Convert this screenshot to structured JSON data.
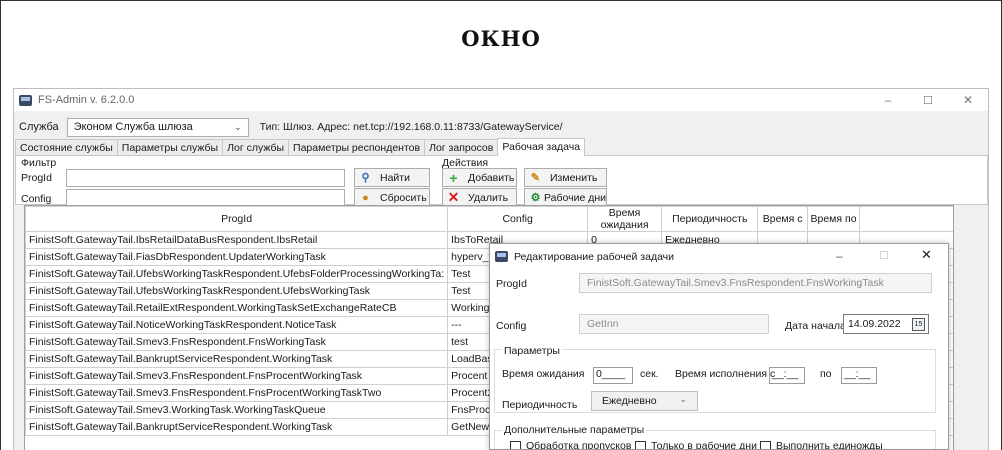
{
  "caption": "ОКНО",
  "window": {
    "title": "FS-Admin v. 6.2.0.0",
    "controls": {
      "minimize": "–",
      "maximize": "☐",
      "close": "✕"
    }
  },
  "service_row": {
    "label": "Служба",
    "selected": "Эконом Служба шлюза",
    "info": "Тип: Шлюз.   Адрес: net.tcp://192.168.0.11:8733/GatewayService/"
  },
  "tabs": [
    "Состояние службы",
    "Параметры службы",
    "Лог службы",
    "Параметры респондентов",
    "Лог запросов",
    "Рабочая задача"
  ],
  "filter": {
    "title": "Фильтр",
    "progid_label": "ProgId",
    "config_label": "Config",
    "find_button": "Найти",
    "reset_button": "Сбросить"
  },
  "actions": {
    "title": "Действия",
    "add": "Добавить",
    "edit": "Изменить",
    "delete": "Удалить",
    "workdays": "Рабочие дни"
  },
  "grid": {
    "columns": [
      "ProgId",
      "Config",
      "Время ожидания",
      "Периодичность",
      "Время с",
      "Время по"
    ],
    "rows": [
      [
        "FinistSoft.GatewayTail.IbsRetailDataBusRespondent.IbsRetail",
        "IbsToRetail",
        "0",
        "Ежедневно",
        "",
        ""
      ],
      [
        "FinistSoft.GatewayTail.FiasDbRespondent.UpdaterWorkingTask",
        "hyperv_fias",
        "",
        "",
        "",
        ""
      ],
      [
        "FinistSoft.GatewayTail.UfebsWorkingTaskRespondent.UfebsFolderProcessingWorkingTa:",
        "Test",
        "",
        "",
        "",
        ""
      ],
      [
        "FinistSoft.GatewayTail.UfebsWorkingTaskRespondent.UfebsWorkingTask",
        "Test",
        "",
        "",
        "",
        ""
      ],
      [
        "FinistSoft.GatewayTail.RetailExtRespondent.WorkingTaskSetExchangeRateCB",
        "WorkingTaskSetExcha",
        "",
        "",
        "",
        ""
      ],
      [
        "FinistSoft.GatewayTail.NoticeWorkingTaskRespondent.NoticeTask",
        "---",
        "",
        "",
        "",
        ""
      ],
      [
        "FinistSoft.GatewayTail.Smev3.FnsRespondent.FnsWorkingTask",
        "test",
        "",
        "",
        "",
        ""
      ],
      [
        "FinistSoft.GatewayTail.BankruptServiceRespondent.WorkingTask",
        "LoadBase",
        "",
        "",
        "",
        ""
      ],
      [
        "FinistSoft.GatewayTail.Smev3.FnsRespondent.FnsProcentWorkingTask",
        "Procent",
        "",
        "",
        "",
        ""
      ],
      [
        "FinistSoft.GatewayTail.Smev3.FnsRespondent.FnsProcentWorkingTaskTwo",
        "Procent2",
        "",
        "",
        "",
        ""
      ],
      [
        "FinistSoft.GatewayTail.Smev3.WorkingTask.WorkingTaskQueue",
        "FnsProc",
        "",
        "",
        "",
        ""
      ],
      [
        "FinistSoft.GatewayTail.BankruptServiceRespondent.WorkingTask",
        "GetNewMessage",
        "",
        "",
        "",
        ""
      ]
    ]
  },
  "dialog": {
    "title": "Редактирование рабочей задачи",
    "progid_label": "ProgId",
    "progid_value": "FinistSoft.GatewayTail.Smev3.FnsRespondent.FnsWorkingTask",
    "config_label": "Config",
    "config_value": "GetInn",
    "start_date_label": "Дата начала",
    "start_date_value": "14.09.2022",
    "params_title": "Параметры",
    "wait_label": "Время ожидания",
    "wait_value": "0____",
    "wait_unit": "сек.",
    "exec_time_label": "Время исполнения с",
    "exec_from": "__:__",
    "exec_to_label": "по",
    "exec_to": "__:__",
    "period_label": "Периодичность",
    "period_value": "Ежедневно",
    "extra_title": "Дополнительные параметры",
    "chk_skip": "Обработка пропусков",
    "chk_workdays": "Только в рабочие дни",
    "chk_once": "Выполнить единожды"
  }
}
